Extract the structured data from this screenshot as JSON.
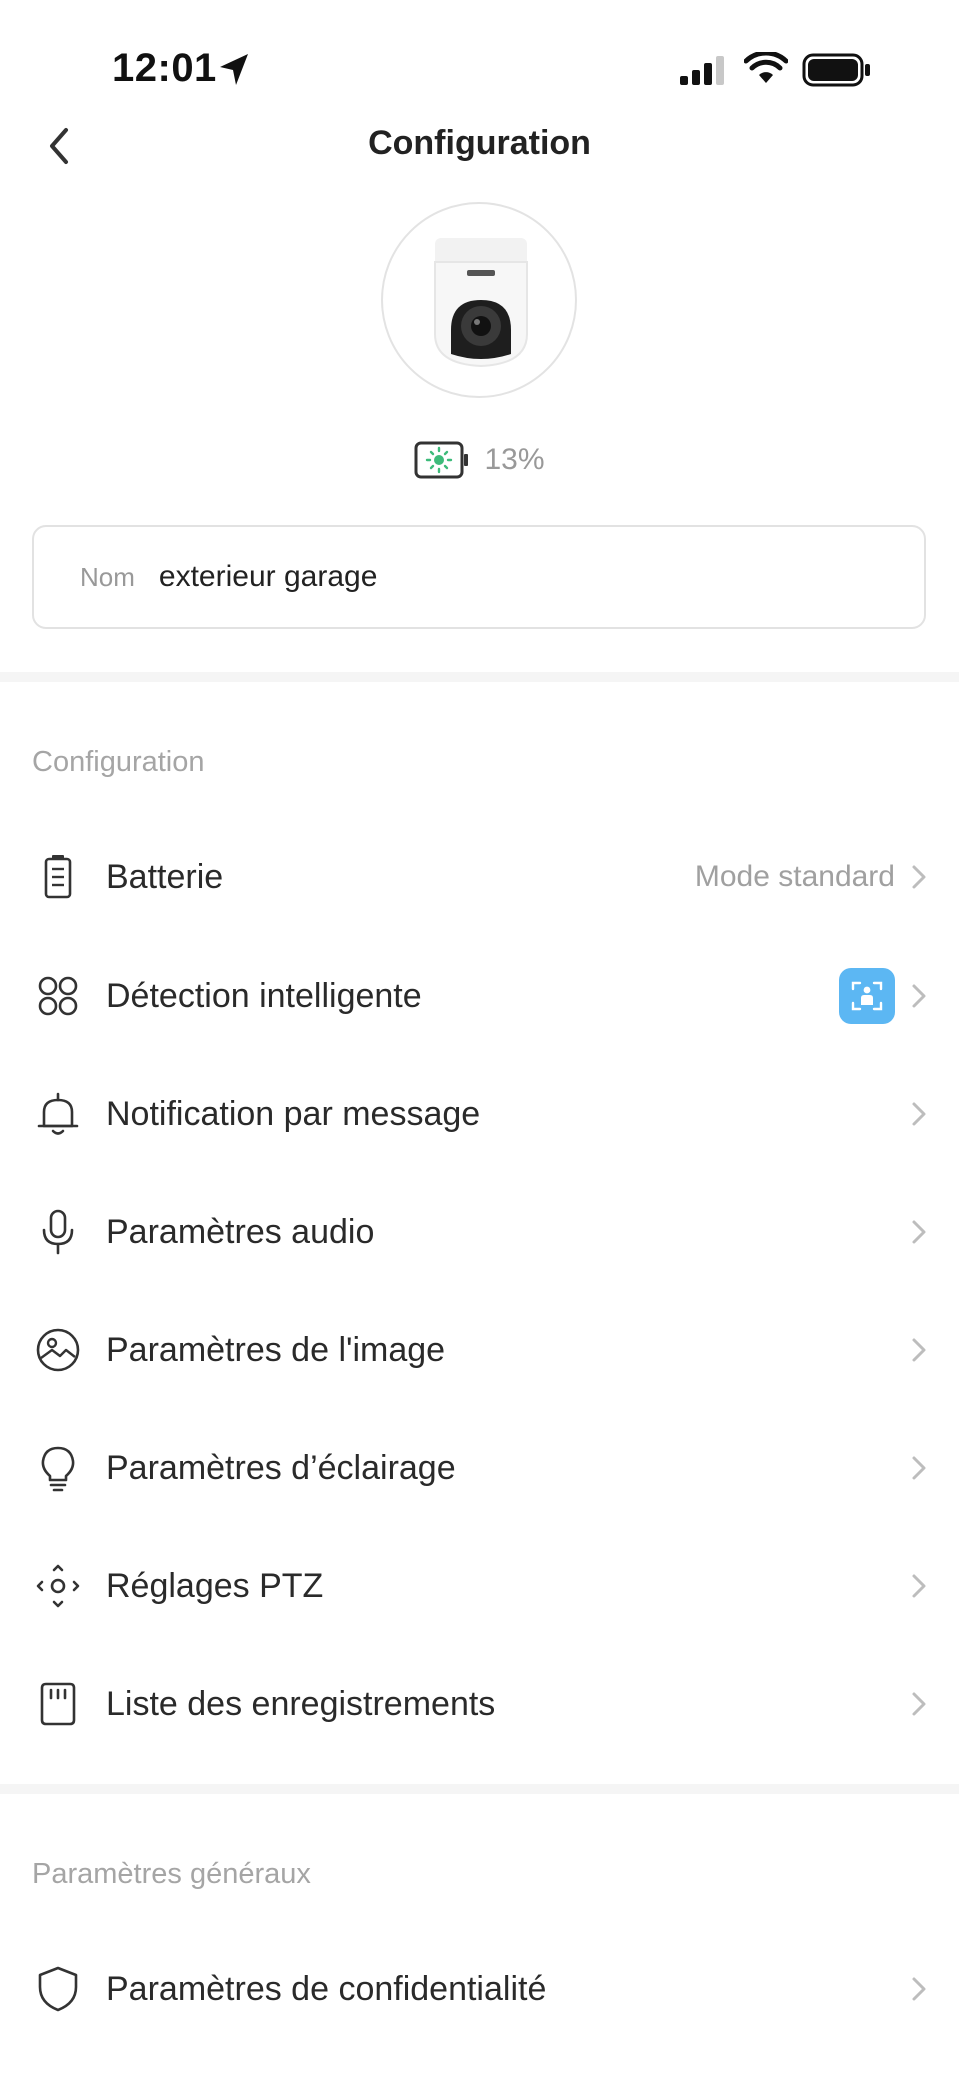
{
  "status_bar": {
    "time": "12:01"
  },
  "nav": {
    "title": "Configuration"
  },
  "device": {
    "battery_percent": "13%"
  },
  "name_field": {
    "label": "Nom",
    "value": "exterieur garage"
  },
  "sections": {
    "configuration": "Configuration",
    "general": "Paramètres généraux"
  },
  "menu": {
    "battery": {
      "label": "Batterie",
      "value": "Mode standard",
      "icon": "battery-icon"
    },
    "smart_detection": {
      "label": "Détection intelligente",
      "icon": "grid-circles-icon",
      "badge_icon": "person-detection-icon"
    },
    "notification": {
      "label": "Notification par message",
      "icon": "bell-icon"
    },
    "audio": {
      "label": "Paramètres audio",
      "icon": "microphone-icon"
    },
    "image": {
      "label": "Paramètres de l'image",
      "icon": "image-icon"
    },
    "lighting": {
      "label": "Paramètres d’éclairage",
      "icon": "lightbulb-icon"
    },
    "ptz": {
      "label": "Réglages PTZ",
      "icon": "ptz-icon"
    },
    "recordings": {
      "label": "Liste des enregistrements",
      "icon": "sd-card-icon"
    },
    "privacy": {
      "label": "Paramètres de confidentialité",
      "icon": "shield-icon"
    }
  },
  "colors": {
    "accent": "#5cb7f3",
    "battery_green": "#3dbb7a",
    "secondary_text": "#a0a0a0",
    "divider": "#f5f5f5"
  }
}
